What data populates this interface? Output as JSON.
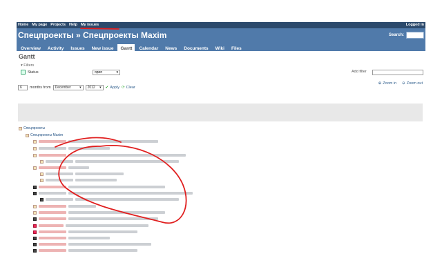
{
  "topmenu": {
    "links": [
      "Home",
      "My page",
      "Projects",
      "Help",
      "My issues"
    ],
    "login_text": "Logged in"
  },
  "header": {
    "title": "Спецпроекты » Спецпроекты Maxim",
    "search_label": "Search:"
  },
  "tabs": [
    "Overview",
    "Activity",
    "Issues",
    "New issue",
    "Gantt",
    "Calendar",
    "News",
    "Documents",
    "Wiki",
    "Files"
  ],
  "selected_tab": "Gantt",
  "page": {
    "title": "Gantt",
    "filters_label": "Filters",
    "status_label": "Status",
    "status_value": "open",
    "add_filter_label": "Add filter"
  },
  "controls": {
    "months_value": "6",
    "months_from_label": "months from",
    "month_value": "December",
    "year_value": "2012",
    "apply_label": "Apply",
    "clear_label": "Clear",
    "zoom_in_label": "Zoom in",
    "zoom_out_label": "Zoom out"
  },
  "tree": {
    "root_project": "Спецпроекты",
    "sub_project": "Спецпроекты Maxim"
  },
  "colors": {
    "header_bg": "#507aaa",
    "topmenu_bg": "#2c4a6c",
    "annotation": "#e02020"
  }
}
